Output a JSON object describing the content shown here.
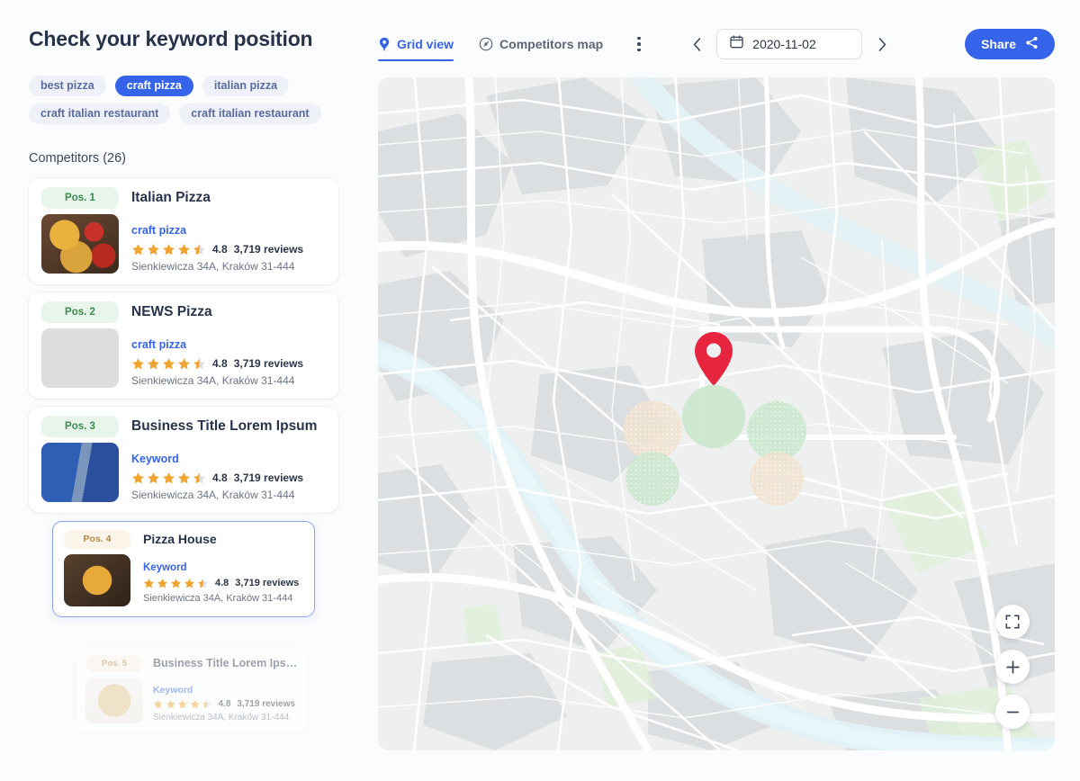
{
  "page": {
    "title": "Check your keyword position",
    "competitors_label": "Competitors (26)",
    "accent_color": "#3563e9",
    "badge_green_bg": "#e7f5ea",
    "badge_green_text": "#3e8b52",
    "badge_tan_bg": "#fbf4e8",
    "badge_tan_text": "#b08a49",
    "page_bg": "#fbfcfd"
  },
  "keywords": [
    {
      "label": "best pizza",
      "active": false
    },
    {
      "label": "craft pizza",
      "active": true
    },
    {
      "label": "italian pizza",
      "active": false
    },
    {
      "label": "craft italian restaurant",
      "active": false
    },
    {
      "label": "craft italian restaurant",
      "active": false
    }
  ],
  "toolbar": {
    "tabs": [
      {
        "label": "Grid view",
        "icon": "map-pin-icon",
        "active": true
      },
      {
        "label": "Competitors map",
        "icon": "compass-icon",
        "active": false
      }
    ],
    "more_menu_icon": "kebab-menu-icon",
    "prev_label": "‹",
    "next_label": "›",
    "date_value": "2020-11-02",
    "date_icon": "calendar-icon",
    "share_label": "Share",
    "share_icon": "share-icon"
  },
  "competitors": [
    {
      "position": "Pos. 1",
      "badge_style": "green",
      "name": "Italian Pizza",
      "keyword": "craft pizza",
      "rating": "4.8",
      "stars": 4.5,
      "reviews": "3,719 reviews",
      "address": "Sienkiewicza 34A, Kraków 31-444",
      "state": "normal",
      "thumb": "pizza-slices-photo"
    },
    {
      "position": "Pos. 2",
      "badge_style": "green",
      "name": "NEWS Pizza",
      "keyword": "craft pizza",
      "rating": "4.8",
      "stars": 4.5,
      "reviews": "3,719 reviews",
      "address": "Sienkiewicza 34A, Kraków 31-444",
      "state": "normal",
      "thumb": "flying-toppings-photo"
    },
    {
      "position": "Pos. 3",
      "badge_style": "green",
      "name": "Business Title Lorem Ipsum",
      "keyword": "Keyword",
      "rating": "4.8",
      "stars": 4.5,
      "reviews": "3,719 reviews",
      "address": "Sienkiewicza 34A, Kraków 31-444",
      "state": "normal",
      "thumb": "open-sign-photo"
    },
    {
      "position": "Pos. 4",
      "badge_style": "tan",
      "name": "Pizza House",
      "keyword": "Keyword",
      "rating": "4.8",
      "stars": 4.5,
      "reviews": "3,719 reviews",
      "address": "Sienkiewicza 34A, Kraków 31-444",
      "state": "selected",
      "thumb": "pizza-top-view-photo"
    },
    {
      "position": "Pos. 5",
      "badge_style": "tan",
      "name": "Business Title Lorem Ipsum",
      "keyword": "Keyword",
      "rating": "4.8",
      "stars": 4.5,
      "reviews": "3,719 reviews",
      "address": "Sienkiewicza 34A, Kraków 31-444",
      "state": "faded",
      "thumb": "sliced-pizza-photo"
    }
  ],
  "map": {
    "marker_color": "#e8253f",
    "marker_label": "location-marker",
    "controls": [
      {
        "name": "fullscreen-button",
        "icon": "expand-icon"
      },
      {
        "name": "zoom-in-button",
        "icon": "plus-icon"
      },
      {
        "name": "zoom-out-button",
        "icon": "minus-icon"
      }
    ],
    "overlay_circles": [
      {
        "color": "#c9e6cc",
        "label": "green-coverage-circle"
      },
      {
        "color": "#f0e2cf",
        "label": "beige-coverage-circle"
      }
    ]
  }
}
